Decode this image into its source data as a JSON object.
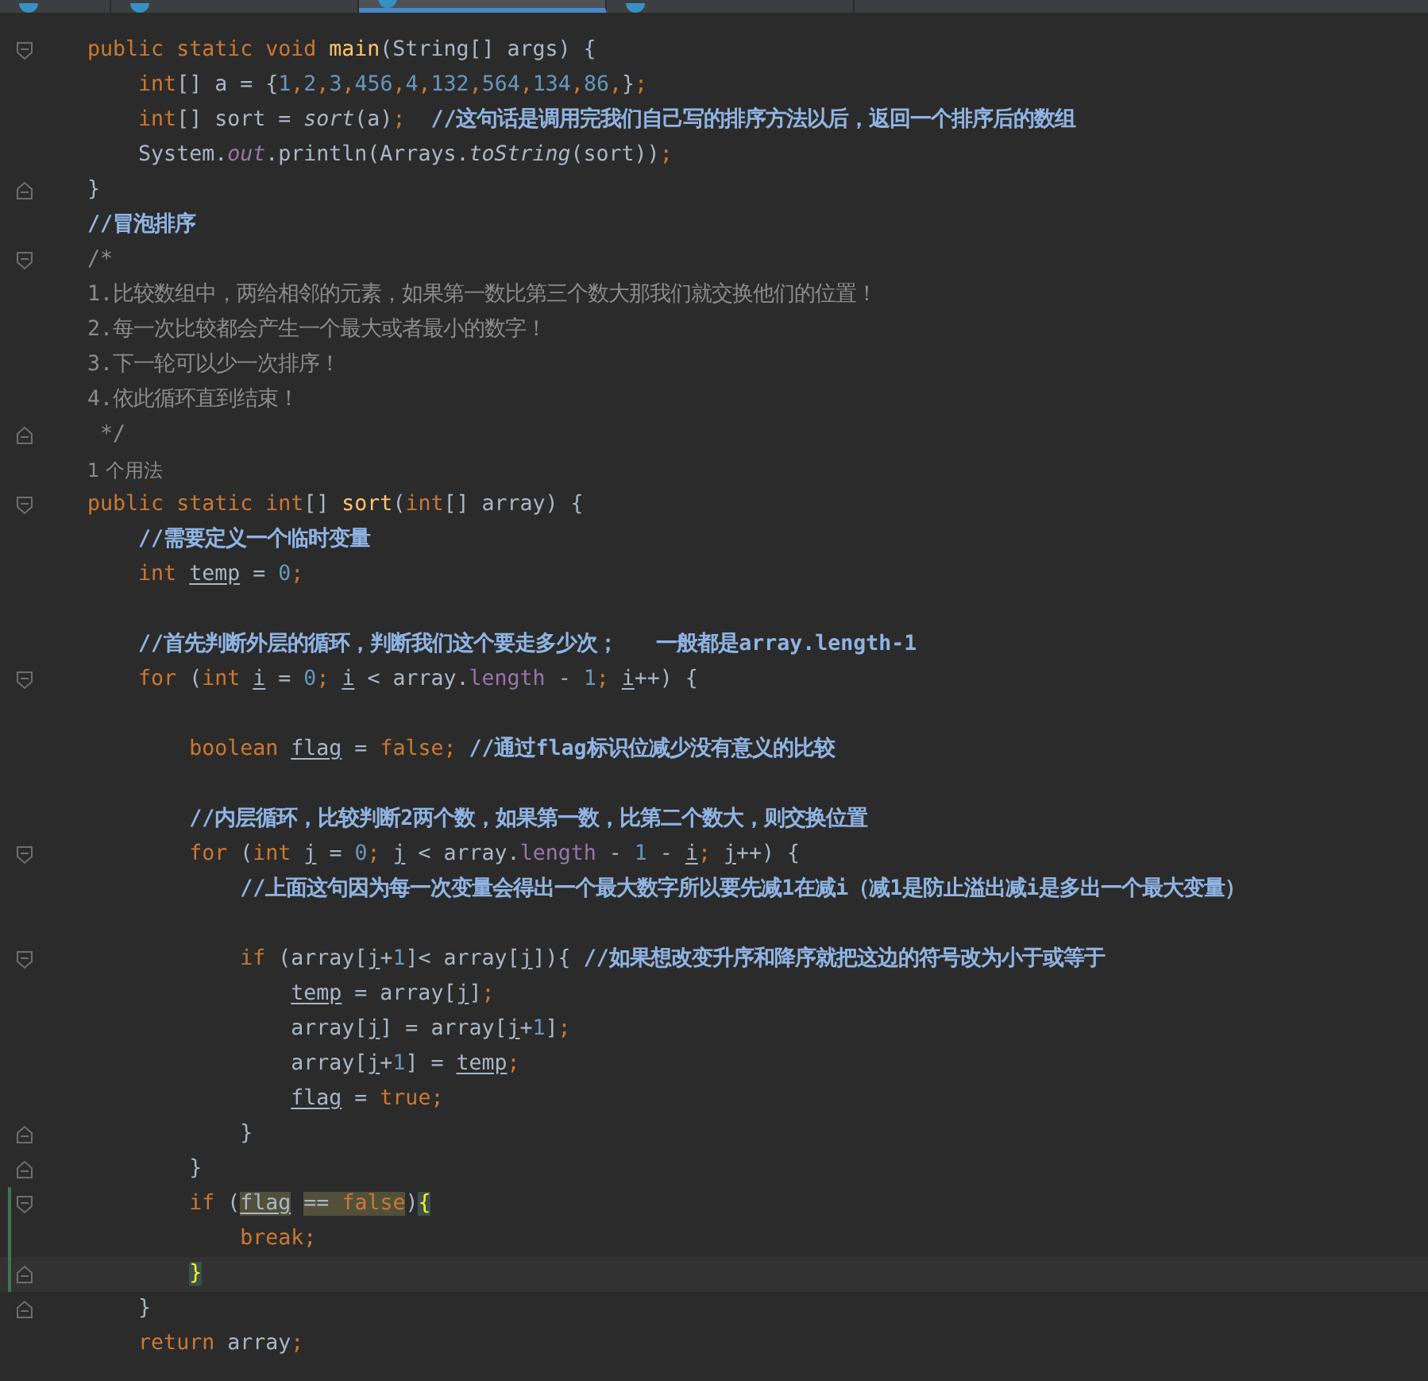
{
  "tabs": [
    {
      "selected": false
    },
    {
      "selected": false
    },
    {
      "selected": true
    },
    {
      "selected": false
    }
  ],
  "lines": [
    {
      "kind": "blank"
    },
    {
      "kind": "code",
      "fold_start": true,
      "tokens": [
        {
          "text": "    public static void ",
          "kind": "kw"
        },
        {
          "text": "main",
          "kind": "fn"
        },
        {
          "text": "(String[] args) {",
          "kind": "plain"
        }
      ]
    },
    {
      "kind": "code",
      "tokens": [
        {
          "text": "        int",
          "kind": "kw"
        },
        {
          "text": "[] a = {",
          "kind": "plain"
        },
        {
          "text": "1",
          "kind": "num"
        },
        {
          "text": ",",
          "kind": "kw"
        },
        {
          "text": "2",
          "kind": "num"
        },
        {
          "text": ",",
          "kind": "kw"
        },
        {
          "text": "3",
          "kind": "num"
        },
        {
          "text": ",",
          "kind": "kw"
        },
        {
          "text": "456",
          "kind": "num"
        },
        {
          "text": ",",
          "kind": "kw"
        },
        {
          "text": "4",
          "kind": "num"
        },
        {
          "text": ",",
          "kind": "kw"
        },
        {
          "text": "132",
          "kind": "num"
        },
        {
          "text": ",",
          "kind": "kw"
        },
        {
          "text": "564",
          "kind": "num"
        },
        {
          "text": ",",
          "kind": "kw"
        },
        {
          "text": "134",
          "kind": "num"
        },
        {
          "text": ",",
          "kind": "kw"
        },
        {
          "text": "86",
          "kind": "num"
        },
        {
          "text": ",",
          "kind": "kw"
        },
        {
          "text": "}",
          "kind": "plain"
        },
        {
          "text": ";",
          "kind": "kw"
        }
      ]
    },
    {
      "kind": "code",
      "tokens": [
        {
          "text": "        int",
          "kind": "kw"
        },
        {
          "text": "[] sort = ",
          "kind": "plain"
        },
        {
          "text": "sort",
          "kind": "static"
        },
        {
          "text": "(a)",
          "kind": "plain"
        },
        {
          "text": ";  ",
          "kind": "kw"
        },
        {
          "text": "//这句话是调用完我们自己写的排序方法以后，返回一个排序后的数组",
          "kind": "comment"
        }
      ]
    },
    {
      "kind": "code",
      "tokens": [
        {
          "text": "        System.",
          "kind": "plain"
        },
        {
          "text": "out",
          "kind": "field_static"
        },
        {
          "text": ".println(Arrays.",
          "kind": "plain"
        },
        {
          "text": "toString",
          "kind": "static"
        },
        {
          "text": "(sort))",
          "kind": "plain"
        },
        {
          "text": ";",
          "kind": "kw"
        }
      ]
    },
    {
      "kind": "code",
      "fold_end": true,
      "tokens": [
        {
          "text": "    }",
          "kind": "plain"
        }
      ]
    },
    {
      "kind": "code",
      "tokens": [
        {
          "text": "    //冒泡排序",
          "kind": "comment"
        }
      ]
    },
    {
      "kind": "code",
      "fold_start": true,
      "tokens": [
        {
          "text": "    /*",
          "kind": "doc"
        }
      ]
    },
    {
      "kind": "code",
      "tokens": [
        {
          "text": "    1.比较数组中，两给相邻的元素，如果第一数比第三个数大那我们就交换他们的位置！",
          "kind": "doc"
        }
      ]
    },
    {
      "kind": "code",
      "tokens": [
        {
          "text": "    2.每一次比较都会产生一个最大或者最小的数字！",
          "kind": "doc"
        }
      ]
    },
    {
      "kind": "code",
      "tokens": [
        {
          "text": "    3.下一轮可以少一次排序！",
          "kind": "doc"
        }
      ]
    },
    {
      "kind": "code",
      "tokens": [
        {
          "text": "    4.依此循环直到结束！",
          "kind": "doc"
        }
      ]
    },
    {
      "kind": "code",
      "fold_end": true,
      "tokens": [
        {
          "text": "     */",
          "kind": "doc"
        }
      ]
    },
    {
      "kind": "code",
      "tokens": [
        {
          "text": "    1 个用法",
          "kind": "hint"
        }
      ]
    },
    {
      "kind": "code",
      "fold_start": true,
      "tokens": [
        {
          "text": "    public static int",
          "kind": "kw"
        },
        {
          "text": "[] ",
          "kind": "plain"
        },
        {
          "text": "sort",
          "kind": "fn"
        },
        {
          "text": "(",
          "kind": "plain"
        },
        {
          "text": "int",
          "kind": "kw"
        },
        {
          "text": "[] array) {",
          "kind": "plain"
        }
      ]
    },
    {
      "kind": "code",
      "tokens": [
        {
          "text": "        //需要定义一个临时变量",
          "kind": "comment"
        }
      ]
    },
    {
      "kind": "code",
      "tokens": [
        {
          "text": "        int ",
          "kind": "kw"
        },
        {
          "text": "temp",
          "kind": "var"
        },
        {
          "text": " = ",
          "kind": "plain"
        },
        {
          "text": "0",
          "kind": "num"
        },
        {
          "text": ";",
          "kind": "kw"
        }
      ]
    },
    {
      "kind": "blank"
    },
    {
      "kind": "code",
      "tokens": [
        {
          "text": "        //首先判断外层的循环，判断我们这个要走多少次；   一般都是array.length-1",
          "kind": "comment"
        }
      ]
    },
    {
      "kind": "code",
      "fold_start": true,
      "tokens": [
        {
          "text": "        for ",
          "kind": "kw"
        },
        {
          "text": "(",
          "kind": "plain"
        },
        {
          "text": "int ",
          "kind": "kw"
        },
        {
          "text": "i",
          "kind": "var"
        },
        {
          "text": " = ",
          "kind": "plain"
        },
        {
          "text": "0",
          "kind": "num"
        },
        {
          "text": "; ",
          "kind": "kw"
        },
        {
          "text": "i",
          "kind": "var"
        },
        {
          "text": " < array.",
          "kind": "plain"
        },
        {
          "text": "length",
          "kind": "field"
        },
        {
          "text": " - ",
          "kind": "plain"
        },
        {
          "text": "1",
          "kind": "num"
        },
        {
          "text": "; ",
          "kind": "kw"
        },
        {
          "text": "i",
          "kind": "var"
        },
        {
          "text": "++) {",
          "kind": "plain"
        }
      ]
    },
    {
      "kind": "blank"
    },
    {
      "kind": "code",
      "tokens": [
        {
          "text": "            boolean ",
          "kind": "kw"
        },
        {
          "text": "flag",
          "kind": "var"
        },
        {
          "text": " = ",
          "kind": "plain"
        },
        {
          "text": "false; ",
          "kind": "kw"
        },
        {
          "text": "//通过flag标识位减少没有意义的比较",
          "kind": "comment"
        }
      ]
    },
    {
      "kind": "blank"
    },
    {
      "kind": "code",
      "tokens": [
        {
          "text": "            //内层循环，比较判断2两个数，如果第一数，比第二个数大，则交换位置",
          "kind": "comment"
        }
      ]
    },
    {
      "kind": "code",
      "fold_start": true,
      "tokens": [
        {
          "text": "            for ",
          "kind": "kw"
        },
        {
          "text": "(",
          "kind": "plain"
        },
        {
          "text": "int ",
          "kind": "kw"
        },
        {
          "text": "j",
          "kind": "var"
        },
        {
          "text": " = ",
          "kind": "plain"
        },
        {
          "text": "0",
          "kind": "num"
        },
        {
          "text": "; ",
          "kind": "kw"
        },
        {
          "text": "j",
          "kind": "var"
        },
        {
          "text": " < array.",
          "kind": "plain"
        },
        {
          "text": "length",
          "kind": "field"
        },
        {
          "text": " - ",
          "kind": "plain"
        },
        {
          "text": "1",
          "kind": "num"
        },
        {
          "text": " - ",
          "kind": "plain"
        },
        {
          "text": "i",
          "kind": "var"
        },
        {
          "text": "; ",
          "kind": "kw"
        },
        {
          "text": "j",
          "kind": "var"
        },
        {
          "text": "++) {",
          "kind": "plain"
        }
      ]
    },
    {
      "kind": "code",
      "tokens": [
        {
          "text": "                //上面这句因为每一次变量会得出一个最大数字所以要先减1在减i（减1是防止溢出减i是多出一个最大变量）",
          "kind": "comment"
        }
      ]
    },
    {
      "kind": "blank"
    },
    {
      "kind": "code",
      "fold_start": true,
      "tokens": [
        {
          "text": "                if ",
          "kind": "kw"
        },
        {
          "text": "(array[",
          "kind": "plain"
        },
        {
          "text": "j",
          "kind": "var"
        },
        {
          "text": "+",
          "kind": "plain"
        },
        {
          "text": "1",
          "kind": "num"
        },
        {
          "text": "]< array[",
          "kind": "plain"
        },
        {
          "text": "j",
          "kind": "var"
        },
        {
          "text": "]){ ",
          "kind": "plain"
        },
        {
          "text": "//如果想改变升序和降序就把这边的符号改为小于或等于",
          "kind": "comment"
        }
      ]
    },
    {
      "kind": "code",
      "tokens": [
        {
          "text": "                    temp",
          "kind": "var"
        },
        {
          "text": " = array[",
          "kind": "plain"
        },
        {
          "text": "j",
          "kind": "var"
        },
        {
          "text": "]",
          "kind": "plain"
        },
        {
          "text": ";",
          "kind": "kw"
        }
      ]
    },
    {
      "kind": "code",
      "tokens": [
        {
          "text": "                    array[",
          "kind": "plain"
        },
        {
          "text": "j",
          "kind": "var"
        },
        {
          "text": "] = array[",
          "kind": "plain"
        },
        {
          "text": "j",
          "kind": "var"
        },
        {
          "text": "+",
          "kind": "plain"
        },
        {
          "text": "1",
          "kind": "num"
        },
        {
          "text": "]",
          "kind": "plain"
        },
        {
          "text": ";",
          "kind": "kw"
        }
      ]
    },
    {
      "kind": "code",
      "tokens": [
        {
          "text": "                    array[",
          "kind": "plain"
        },
        {
          "text": "j",
          "kind": "var"
        },
        {
          "text": "+",
          "kind": "plain"
        },
        {
          "text": "1",
          "kind": "num"
        },
        {
          "text": "] = ",
          "kind": "plain"
        },
        {
          "text": "temp",
          "kind": "var"
        },
        {
          "text": ";",
          "kind": "kw"
        }
      ]
    },
    {
      "kind": "code",
      "tokens": [
        {
          "text": "                    flag",
          "kind": "var"
        },
        {
          "text": " = ",
          "kind": "plain"
        },
        {
          "text": "true;",
          "kind": "kw"
        }
      ]
    },
    {
      "kind": "code",
      "fold_end": true,
      "tokens": [
        {
          "text": "                }",
          "kind": "plain"
        }
      ]
    },
    {
      "kind": "code",
      "fold_end": true,
      "tokens": [
        {
          "text": "            }",
          "kind": "plain"
        }
      ]
    },
    {
      "kind": "code",
      "fold_start": true,
      "changed": true,
      "tokens": [
        {
          "text": "            if ",
          "kind": "kw"
        },
        {
          "text": "(",
          "kind": "plain"
        },
        {
          "text": "flag",
          "kind": "var",
          "highlighted": true
        },
        {
          "text": " == ",
          "kind": "plain",
          "highlighted": true
        },
        {
          "text": "false",
          "kind": "kw",
          "highlighted": true
        },
        {
          "text": ")",
          "kind": "plain"
        },
        {
          "text": "{",
          "kind": "brace_match"
        }
      ]
    },
    {
      "kind": "code",
      "changed": true,
      "tokens": [
        {
          "text": "                break;",
          "kind": "kw"
        }
      ]
    },
    {
      "kind": "code",
      "fold_end": true,
      "changed": true,
      "current": true,
      "tokens": [
        {
          "text": "            }",
          "kind": "brace_match"
        }
      ]
    },
    {
      "kind": "code",
      "fold_end": true,
      "tokens": [
        {
          "text": "        }",
          "kind": "plain"
        }
      ]
    },
    {
      "kind": "code",
      "tokens": [
        {
          "text": "        return ",
          "kind": "kw"
        },
        {
          "text": "array",
          "kind": "plain"
        },
        {
          "text": ";",
          "kind": "kw"
        }
      ]
    }
  ]
}
